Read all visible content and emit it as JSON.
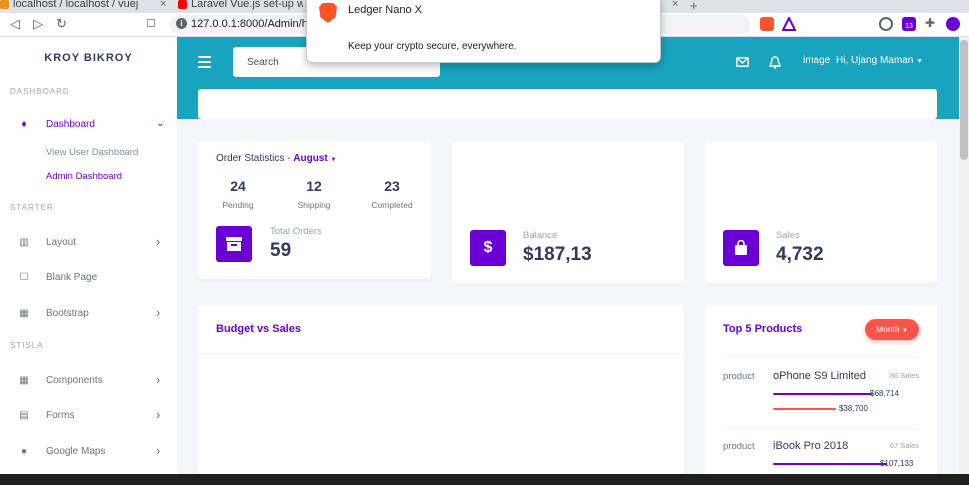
{
  "browser": {
    "tabs": [
      {
        "title": "localhost / localhost / vuej",
        "color": "#f29111"
      },
      {
        "title": "Laravel Vue.js set-up w",
        "color": "#ff0000"
      }
    ],
    "url": "127.0.0.1:8000/Admin/ho",
    "extension_badge": "13"
  },
  "popup": {
    "title": "Ledger Nano X",
    "body": "Keep your crypto secure, everywhere."
  },
  "sidebar": {
    "brand": "KROY BIKROY",
    "header_dashboard": "DASHBOARD",
    "dashboard": "Dashboard",
    "sub_user": "View User Dashboard",
    "sub_admin": "Admin Dashboard",
    "header_starter": "STARTER",
    "layout": "Layout",
    "blank": "Blank Page",
    "bootstrap": "Bootstrap",
    "header_stisla": "STISLA",
    "components": "Components",
    "forms": "Forms",
    "maps": "Google Maps"
  },
  "topbar": {
    "search_placeholder": "Search",
    "avatar_alt": "image",
    "greeting": "Hi, Ujang Maman"
  },
  "order_stats": {
    "title": "Order Statistics -",
    "month": "August",
    "pending_count": "24",
    "pending_label": "Pending",
    "shipping_count": "12",
    "shipping_label": "Shipping",
    "completed_count": "23",
    "completed_label": "Completed",
    "total_label": "Total Orders",
    "total_value": "59"
  },
  "balance": {
    "label": "Balance",
    "value": "$187,13"
  },
  "sales": {
    "label": "Sales",
    "value": "4,732"
  },
  "budget": {
    "title": "Budget vs Sales"
  },
  "top_products": {
    "title": "Top 5 Products",
    "filter": "Month",
    "items": [
      {
        "img_alt": "product",
        "name": "oPhone S9 Limited",
        "sales": "86 Sales",
        "v1": "$68,714",
        "v2": "$38,700",
        "f1": 0.68,
        "f2": 0.43
      },
      {
        "img_alt": "product",
        "name": "iBook Pro 2018",
        "sales": "67 Sales",
        "v1": "$107,133",
        "f1": 0.78
      }
    ]
  },
  "colors": {
    "primary": "#6a00d4",
    "topbar": "#18a3be",
    "danger": "#fc544b"
  }
}
